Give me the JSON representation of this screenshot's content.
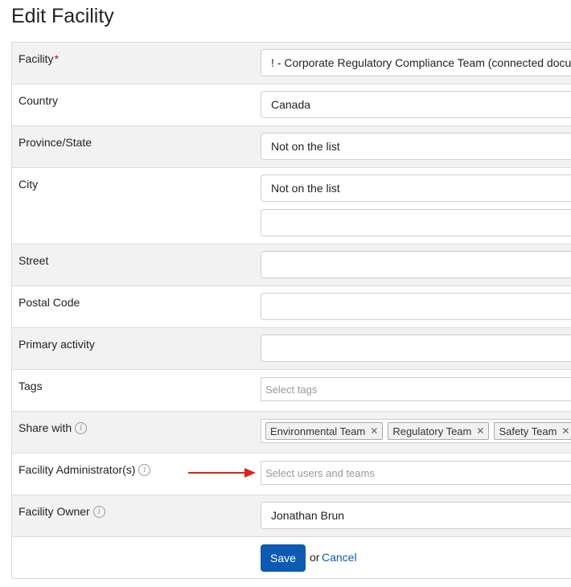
{
  "page": {
    "title": "Edit Facility"
  },
  "form": {
    "facility": {
      "label": "Facility",
      "required_mark": "*",
      "value": "! - Corporate Regulatory Compliance Team (connected documents)"
    },
    "country": {
      "label": "Country",
      "value": "Canada"
    },
    "province": {
      "label": "Province/State",
      "value": "Not on the list"
    },
    "city": {
      "label": "City",
      "value": "Not on the list",
      "other_value": ""
    },
    "street": {
      "label": "Street",
      "value": ""
    },
    "postal_code": {
      "label": "Postal Code",
      "value": ""
    },
    "primary_activity": {
      "label": "Primary activity",
      "value": ""
    },
    "tags": {
      "label": "Tags",
      "placeholder": "Select tags"
    },
    "share_with": {
      "label": "Share with",
      "chips": [
        {
          "label": "Environmental Team"
        },
        {
          "label": "Regulatory Team"
        },
        {
          "label": "Safety Team"
        }
      ]
    },
    "facility_admins": {
      "label": "Facility Administrator(s)",
      "placeholder": "Select users and teams"
    },
    "facility_owner": {
      "label": "Facility Owner",
      "value": "Jonathan Brun"
    }
  },
  "actions": {
    "save": "Save",
    "or": "or",
    "cancel": "Cancel"
  },
  "icons": {
    "info": "info-icon",
    "chip_remove": "close-icon",
    "annotation": "red-arrow"
  },
  "colors": {
    "accent": "#0d5ab3",
    "required": "#d0021b",
    "arrow": "#d9261c",
    "shaded_row": "#f2f2f2"
  }
}
